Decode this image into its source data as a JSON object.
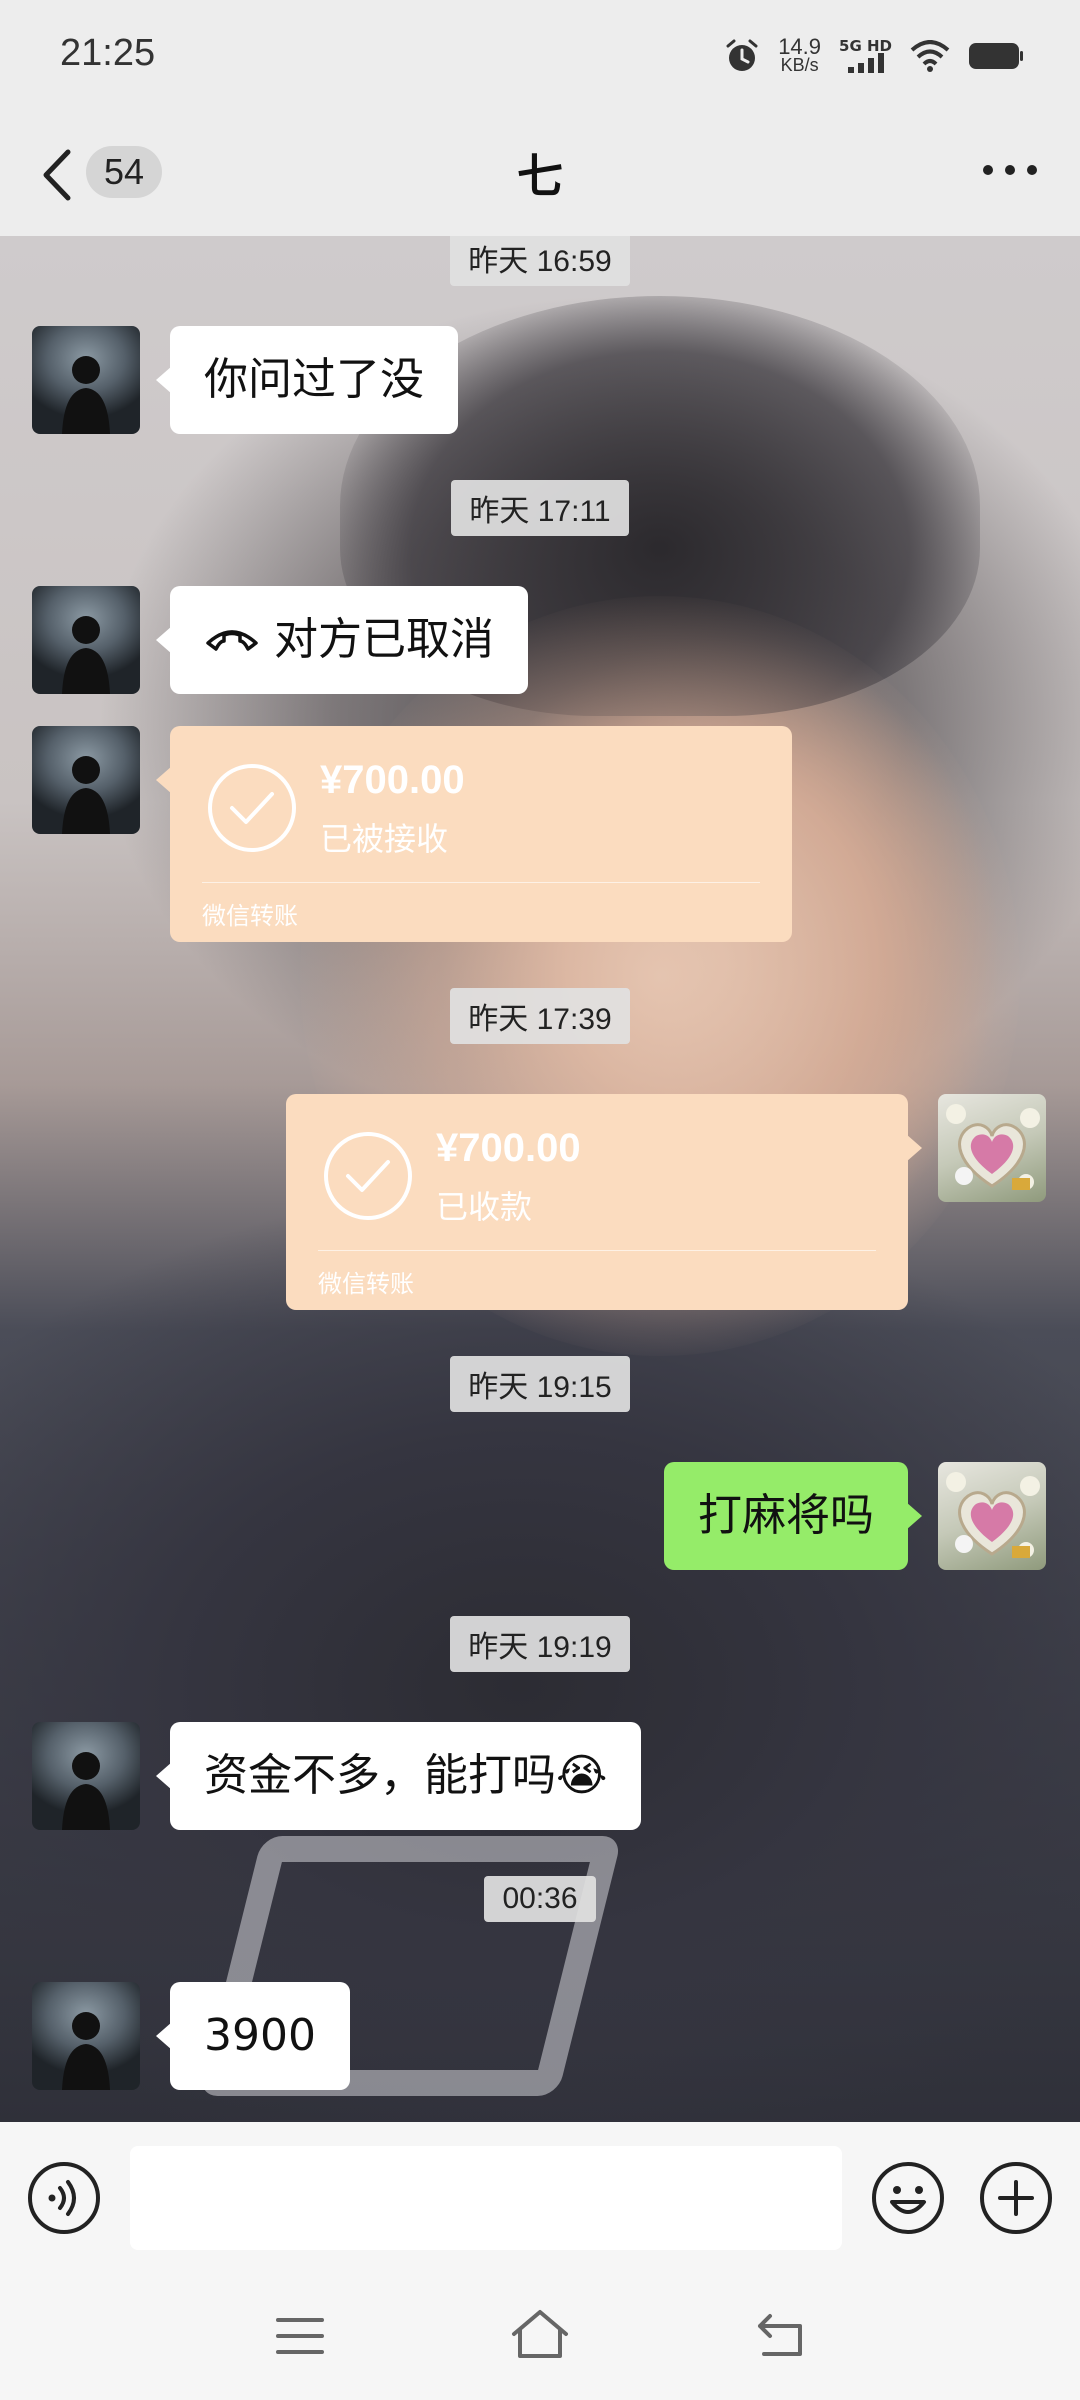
{
  "status_bar": {
    "time": "21:25",
    "net_speed_value": "14.9",
    "net_speed_unit": "KB/s",
    "net_type": "5G HD",
    "icons": [
      "alarm-icon",
      "signal-icon",
      "wifi-icon",
      "battery-icon"
    ]
  },
  "header": {
    "unread_count": "54",
    "title": "七",
    "icons": [
      "back-icon",
      "more-icon"
    ]
  },
  "messages": [
    {
      "kind": "timestamp",
      "text": "昨天 16:59"
    },
    {
      "kind": "text",
      "side": "left",
      "text": "你问过了没"
    },
    {
      "kind": "timestamp",
      "text": "昨天 17:11"
    },
    {
      "kind": "call",
      "side": "left",
      "text": "对方已取消",
      "icon": "phone-hangup-icon"
    },
    {
      "kind": "transfer",
      "side": "left",
      "amount": "¥700.00",
      "status": "已被接收",
      "brand": "微信转账"
    },
    {
      "kind": "timestamp",
      "text": "昨天 17:39"
    },
    {
      "kind": "transfer",
      "side": "right",
      "amount": "¥700.00",
      "status": "已收款",
      "brand": "微信转账"
    },
    {
      "kind": "timestamp",
      "text": "昨天 19:15"
    },
    {
      "kind": "text",
      "side": "right",
      "text": "打麻将吗"
    },
    {
      "kind": "timestamp",
      "text": "昨天 19:19"
    },
    {
      "kind": "text",
      "side": "left",
      "text": "资金不多，能打吗😭"
    },
    {
      "kind": "timestamp",
      "text": "00:36"
    },
    {
      "kind": "text",
      "side": "left",
      "text": "3900"
    }
  ],
  "input_bar": {
    "placeholder": "",
    "value": "",
    "icons": [
      "voice-icon",
      "emoji-icon",
      "plus-icon"
    ]
  },
  "nav_bar": {
    "icons": [
      "menu-icon",
      "home-icon",
      "back-nav-icon"
    ]
  },
  "colors": {
    "sent_bubble": "#95ec69",
    "received_bubble": "#ffffff",
    "transfer_card": "#fbdcbf",
    "header_bg": "#ededed"
  }
}
